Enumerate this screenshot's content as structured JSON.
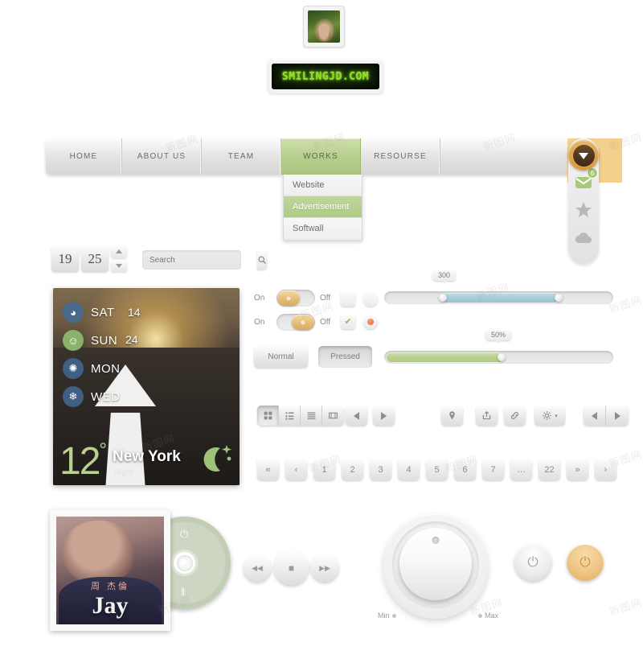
{
  "branding": {
    "avatar_alt": "profile-photo",
    "led_text": "SMILINGJD.COM"
  },
  "nav": {
    "items": [
      {
        "label": "HOME",
        "active": false
      },
      {
        "label": "ABOUT US",
        "active": false
      },
      {
        "label": "TEAM",
        "active": false
      },
      {
        "label": "WORKS",
        "active": true
      },
      {
        "label": "RESOURSE",
        "active": false
      }
    ],
    "dropdown": [
      {
        "label": "Website",
        "active": false
      },
      {
        "label": "Advertisement",
        "active": true
      },
      {
        "label": "Softwall",
        "active": false
      }
    ]
  },
  "rail": {
    "avatar_icon": "user-avatar",
    "chevron_icon": "chevron-down-icon",
    "mail_icon": "mail-icon",
    "mail_badge": "6",
    "star_icon": "star-icon",
    "cloud_icon": "cloud-icon"
  },
  "stepper": {
    "digit_a": "19",
    "digit_b": "25",
    "up_icon": "chevron-up-icon",
    "down_icon": "chevron-down-icon"
  },
  "search": {
    "placeholder": "Search",
    "value": "",
    "icon": "search-icon"
  },
  "weather": {
    "days": [
      {
        "day": "SAT",
        "temp": "14",
        "icon": "wind-icon",
        "color": "#4a6a8c"
      },
      {
        "day": "SUN",
        "temp": "24",
        "icon": "rain-icon",
        "color": "#89b36a"
      },
      {
        "day": "MON",
        "temp": "",
        "icon": "snow-icon",
        "color": "#3f5f83"
      },
      {
        "day": "WED",
        "temp": "",
        "icon": "sleet-icon",
        "color": "#3f5f83"
      }
    ],
    "current_temp": "12",
    "degree": "°",
    "city": "New York",
    "condition": "Night",
    "condition_icon": "moon-stars-icon"
  },
  "toggles": [
    {
      "on_label": "On",
      "off_label": "Off",
      "state": "on"
    },
    {
      "on_label": "On",
      "off_label": "Off",
      "state": "off"
    }
  ],
  "choices": {
    "checkbox_unchecked": "checkbox-unchecked",
    "radio_unselected": "radio-unselected",
    "checkbox_checked": "checkbox-checked",
    "radio_selected": "radio-selected",
    "check_glyph": "✔"
  },
  "sliders": [
    {
      "name": "range-slider",
      "tooltip": "300",
      "fill_color": "#a6cbd8",
      "start_pct": 25,
      "end_pct": 76
    },
    {
      "name": "progress-slider",
      "tooltip": "50%",
      "fill_color": "#aecb83",
      "start_pct": 0,
      "end_pct": 52
    }
  ],
  "state_buttons": {
    "normal": "Normal",
    "pressed": "Pressed"
  },
  "view_toolbar": {
    "items": [
      {
        "icon": "grid-view-icon",
        "pressed": true
      },
      {
        "icon": "list-view-icon",
        "pressed": false
      },
      {
        "icon": "detail-view-icon",
        "pressed": false
      },
      {
        "icon": "filmstrip-view-icon",
        "pressed": false
      }
    ]
  },
  "arrow_buttons": {
    "prev_icon": "triangle-left-icon",
    "next_icon": "triangle-right-icon"
  },
  "action_toolbar": {
    "items": [
      {
        "icon": "location-pin-icon",
        "glyph": "▼"
      },
      {
        "icon": "share-icon",
        "glyph": ""
      },
      {
        "icon": "link-icon",
        "glyph": ""
      },
      {
        "icon": "gear-icon",
        "glyph": "▾"
      }
    ]
  },
  "pagination": {
    "items": [
      {
        "label": "«",
        "name": "first-page"
      },
      {
        "label": "‹",
        "name": "prev-page"
      },
      {
        "label": "1",
        "name": "page-1"
      },
      {
        "label": "2",
        "name": "page-2"
      },
      {
        "label": "3",
        "name": "page-3"
      },
      {
        "label": "4",
        "name": "page-4"
      },
      {
        "label": "5",
        "name": "page-5"
      },
      {
        "label": "6",
        "name": "page-6"
      },
      {
        "label": "7",
        "name": "page-7"
      },
      {
        "label": "…",
        "name": "page-ellipsis"
      },
      {
        "label": "22",
        "name": "page-22"
      },
      {
        "label": "»",
        "name": "next-page-double"
      },
      {
        "label": "›",
        "name": "next-page"
      }
    ]
  },
  "player": {
    "album_title": "Jay",
    "album_artist": "周 杰倫",
    "disc_power_icon": "power-icon",
    "disc_play_icon": "play-icon",
    "disc_pause_icon": "pause-icon",
    "power_glyph": "⏻",
    "play_glyph": "▶",
    "pause_glyph": "‖"
  },
  "transport": {
    "rewind_icon": "rewind-icon",
    "stop_icon": "stop-icon",
    "forward_icon": "fast-forward-icon",
    "rewind_glyph": "◀◀",
    "stop_glyph": "■",
    "forward_glyph": "▶▶"
  },
  "knob": {
    "min_label": "Min",
    "max_label": "Max"
  },
  "power_buttons": {
    "off_name": "power-button-off",
    "on_name": "power-button-on",
    "glyph": "⏻"
  },
  "watermark": {
    "text": "新图网"
  },
  "colors": {
    "accent_green": "#aecb83",
    "accent_amber": "#e3bb74",
    "accent_blue": "#a6cbd8",
    "led_green": "#8ee01e"
  }
}
